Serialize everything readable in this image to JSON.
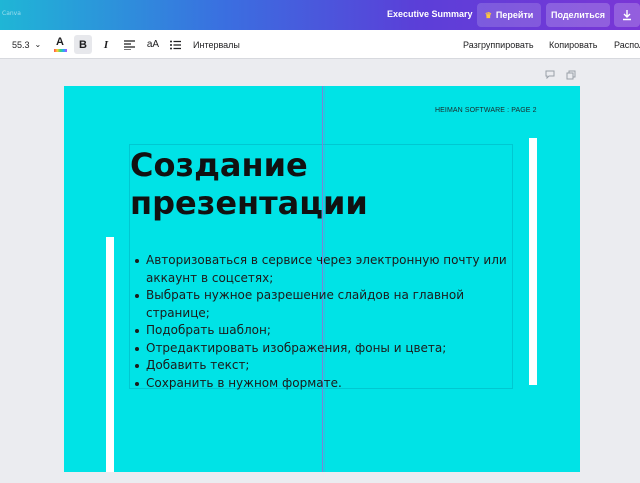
{
  "topbar": {
    "left_faint_text": "Canva",
    "doc_title": "Executive Summary",
    "go_label": "Перейти",
    "share_label": "Поделиться",
    "crown_icon": "crown-icon",
    "download_icon": "download-icon"
  },
  "toolbar": {
    "font_size": "55.3",
    "spacing_label": "Интервалы",
    "ungroup_label": "Разгруппировать",
    "copy_label": "Копировать",
    "arrange_label": "Распол"
  },
  "slide": {
    "page_label": "HEIMAN SOFTWARE : PAGE 2",
    "title": "Создание презентации",
    "bullets": [
      "Авторизоваться в сервисе через электронную почту или аккаунт в соцсетях;",
      "Выбрать нужное разрешение слайдов на главной странице;",
      "Подобрать шаблон;",
      "Отредактировать изображения, фоны и цвета;",
      "Добавить текст;",
      "Сохранить в нужном формате."
    ],
    "background_color": "#00e3e6"
  }
}
